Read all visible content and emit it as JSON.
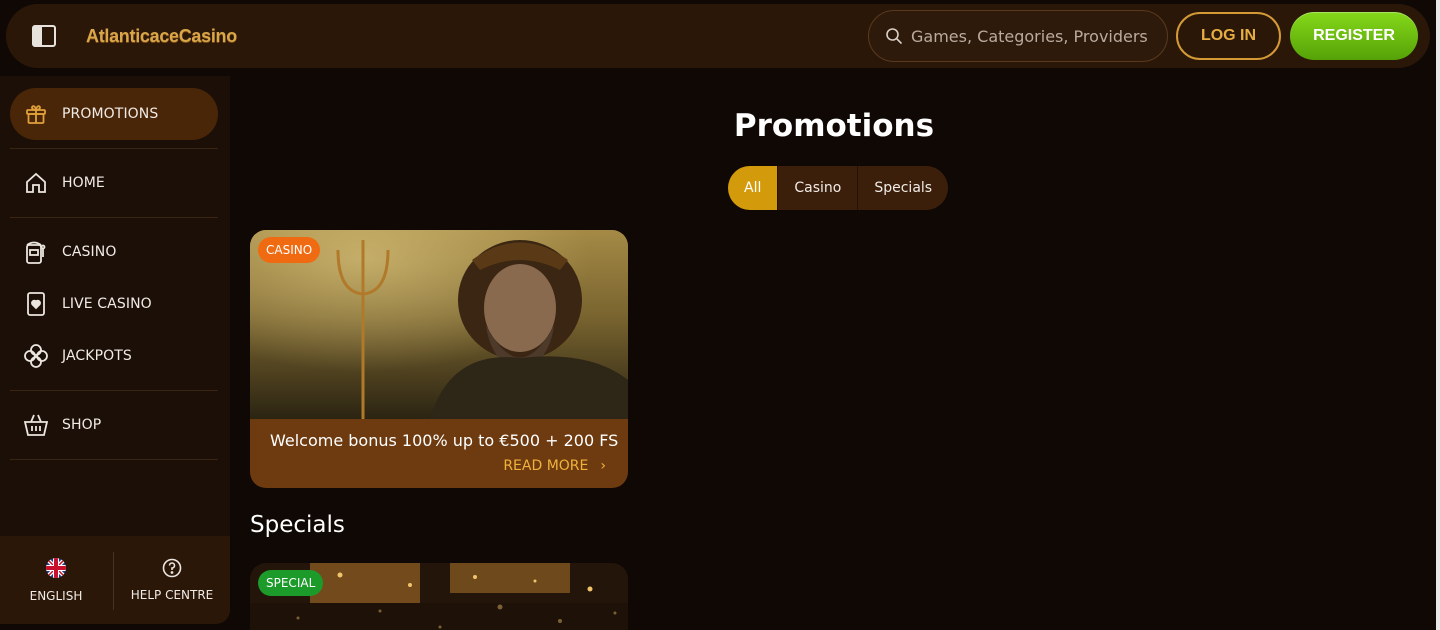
{
  "header": {
    "logo_text": "AtlanticaceCasino",
    "search_placeholder": "Games, Categories, Providers",
    "login_label": "LOG IN",
    "register_label": "REGISTER"
  },
  "sidebar": {
    "items": [
      {
        "label": "PROMOTIONS",
        "icon": "gift-icon",
        "active": true
      },
      {
        "label": "HOME",
        "icon": "home-icon"
      },
      {
        "label": "CASINO",
        "icon": "slot-machine-icon"
      },
      {
        "label": "LIVE CASINO",
        "icon": "playing-card-icon"
      },
      {
        "label": "JACKPOTS",
        "icon": "clover-icon"
      },
      {
        "label": "SHOP",
        "icon": "basket-icon"
      }
    ],
    "footer": {
      "language_label": "ENGLISH",
      "help_label": "HELP CENTRE"
    }
  },
  "main": {
    "title": "Promotions",
    "filters": [
      {
        "label": "All",
        "active": true
      },
      {
        "label": "Casino"
      },
      {
        "label": "Specials"
      }
    ],
    "promo": {
      "badge": "CASINO",
      "text": "Welcome bonus 100% up to €500 + 200 FS",
      "read_more": "READ MORE"
    },
    "specials_title": "Specials",
    "special_badge": "SPECIAL"
  },
  "colors": {
    "accent_gold": "#d39a0c",
    "register_green": "#6cc011",
    "badge_casino": "#f06a12",
    "badge_special": "#1c9a2a"
  }
}
